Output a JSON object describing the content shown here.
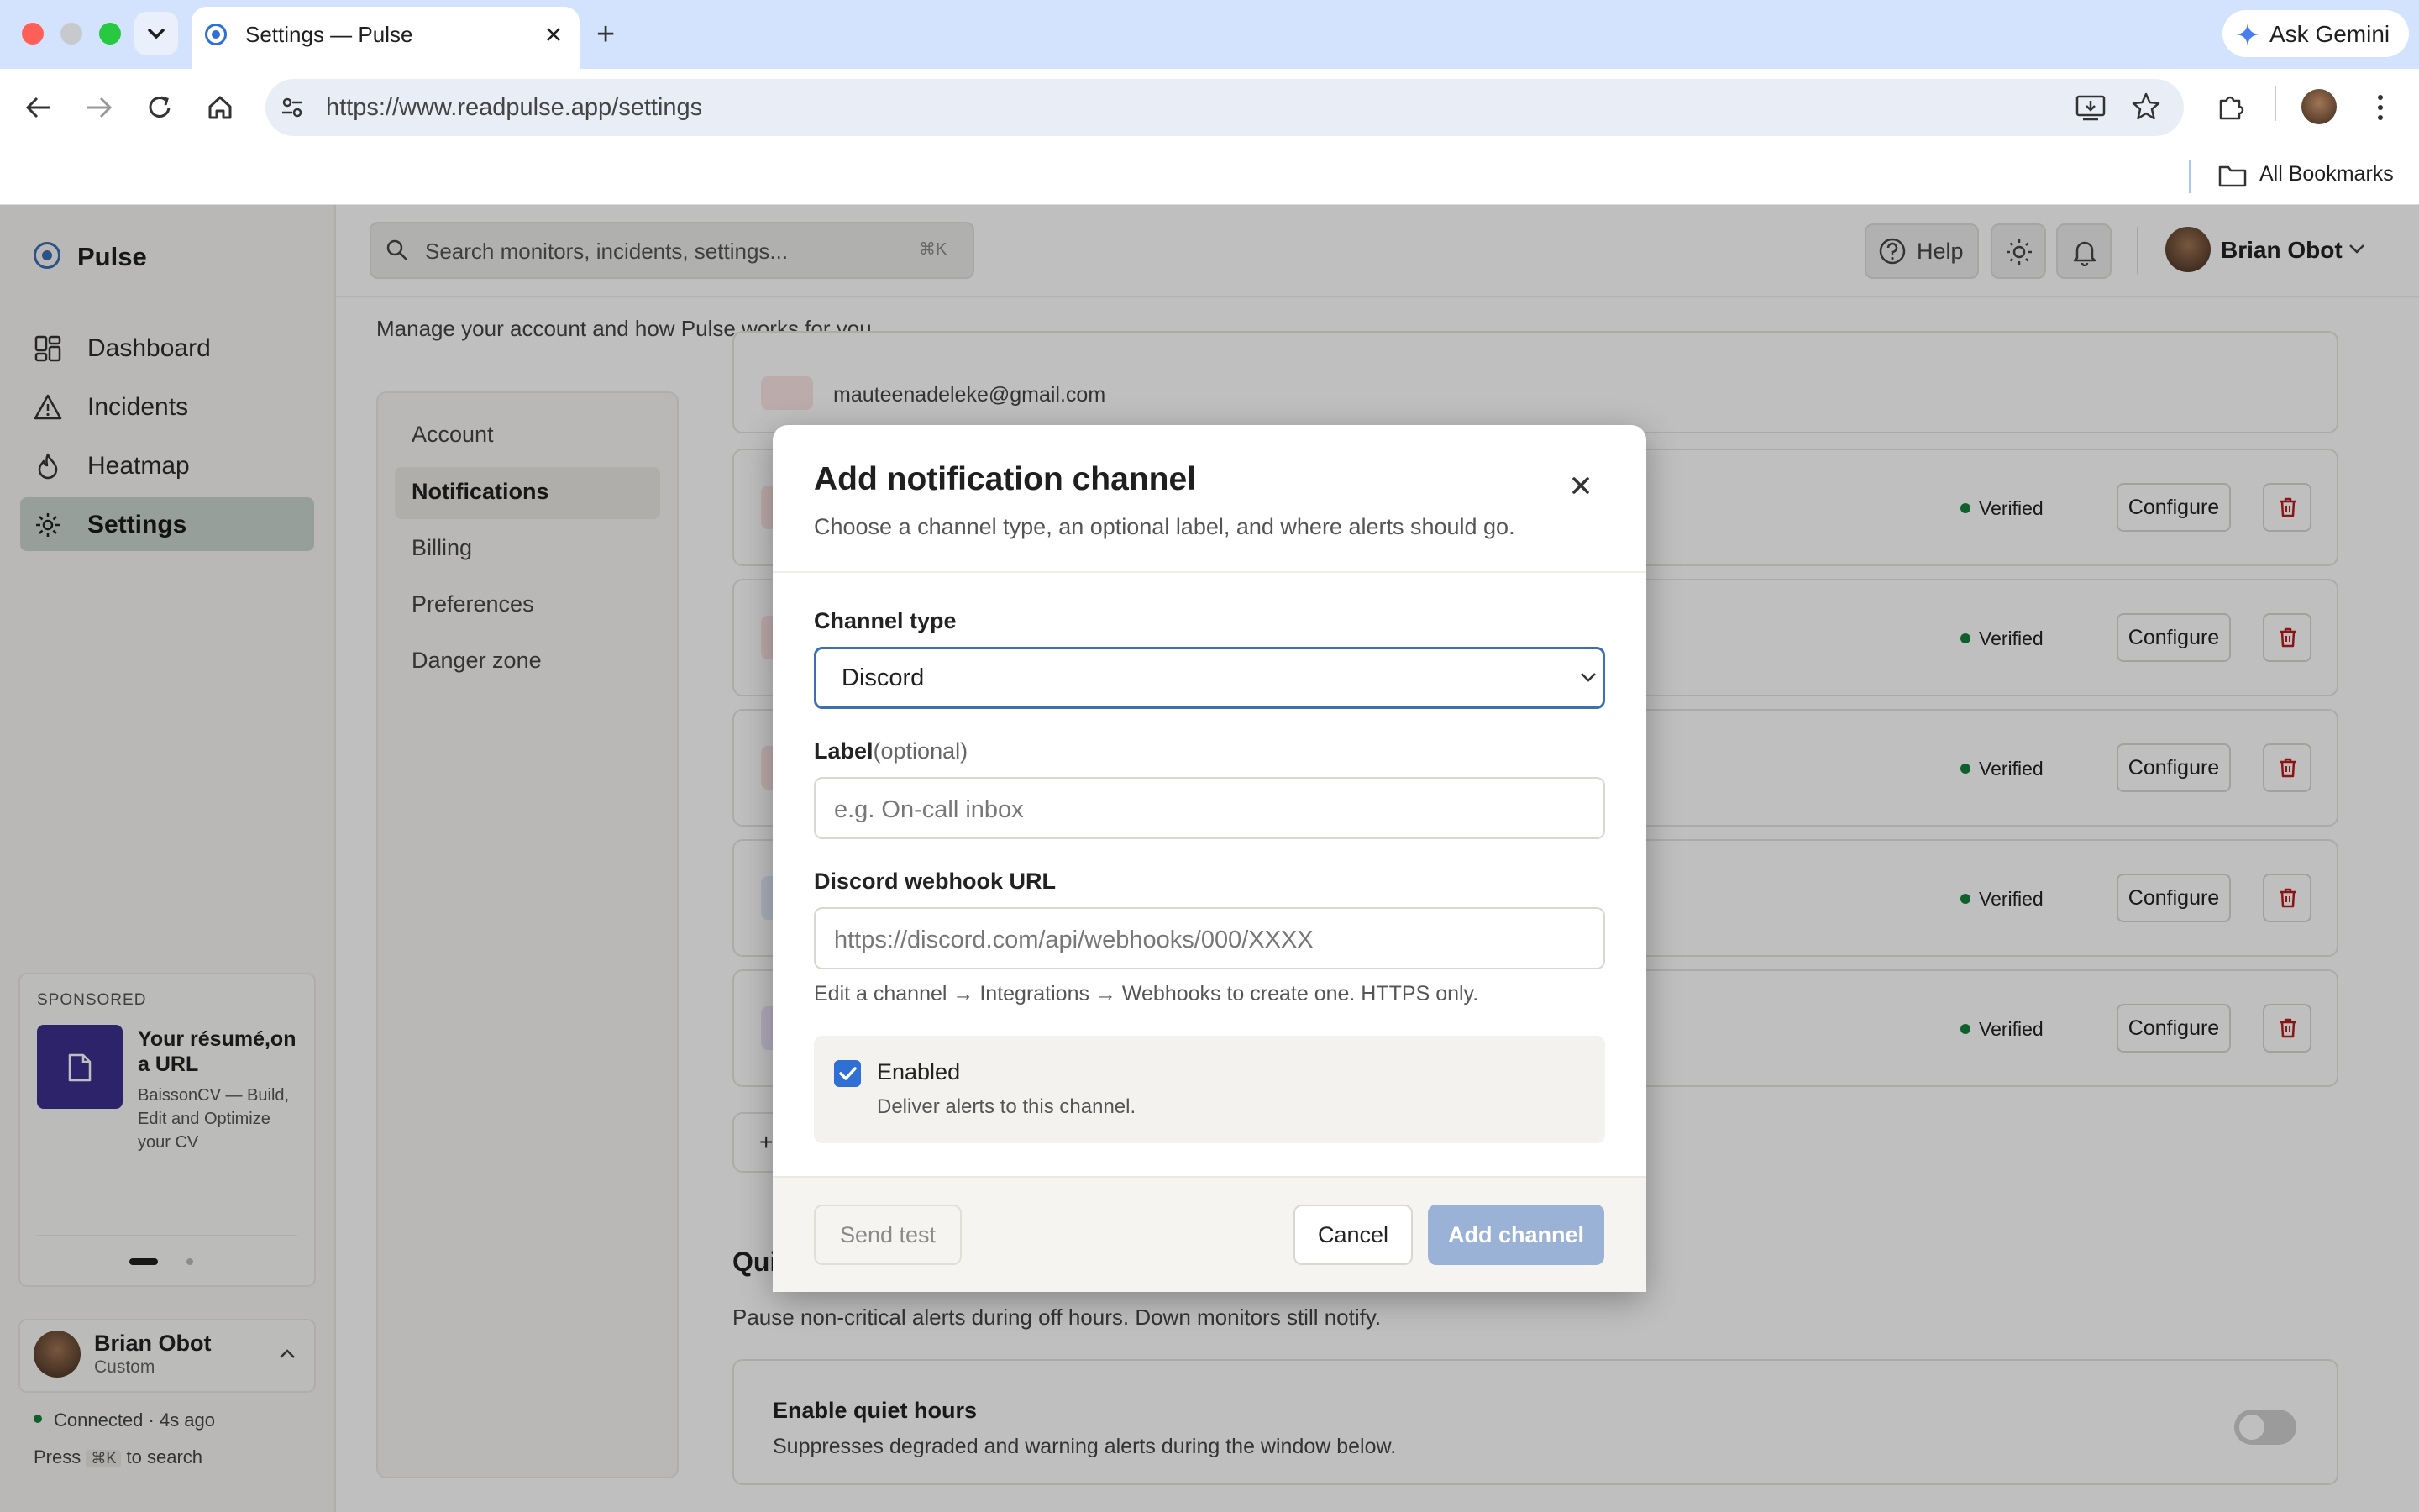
{
  "browser": {
    "tab_title": "Settings — Pulse",
    "url": "https://www.readpulse.app/settings",
    "ask_gemini": "Ask Gemini",
    "bookmarks_label": "All Bookmarks"
  },
  "sidebar": {
    "brand": "Pulse",
    "items": [
      {
        "label": "Dashboard"
      },
      {
        "label": "Incidents"
      },
      {
        "label": "Heatmap"
      },
      {
        "label": "Settings"
      }
    ],
    "sponsored": {
      "tag": "SPONSORED",
      "title": "Your résumé,on a URL",
      "desc": "BaissonCV — Build, Edit and Optimize your CV"
    },
    "user": {
      "name": "Brian Obot",
      "role": "Custom"
    },
    "status": "Connected · 4s ago",
    "press": "Press",
    "press_kbd": "⌘K",
    "to_search": "to search"
  },
  "header": {
    "search_placeholder": "Search monitors, incidents, settings...",
    "search_kbd": "⌘K",
    "help": "Help",
    "user_name": "Brian Obot"
  },
  "page": {
    "subtitle": "Manage your account and how Pulse works for you.",
    "settings_nav": [
      "Account",
      "Notifications",
      "Billing",
      "Preferences",
      "Danger zone"
    ],
    "email": "mauteenadeleke@gmail.com",
    "channels": [
      {
        "status": "Verified",
        "action": "Configure"
      },
      {
        "status": "Verified",
        "action": "Configure"
      },
      {
        "status": "Verified",
        "action": "Configure"
      },
      {
        "status": "Verified",
        "action": "Configure"
      },
      {
        "status": "Verified",
        "action": "Configure"
      }
    ],
    "quiet_heading": "Qui",
    "quiet_desc": "Pause non-critical alerts during off hours. Down monitors still notify.",
    "quiet_title": "Enable quiet hours",
    "quiet_subtitle": "Suppresses degraded and warning alerts during the window below.",
    "quiet_enabled": false
  },
  "modal": {
    "title": "Add notification channel",
    "desc": "Choose a channel type, an optional label, and where alerts should go.",
    "channel_type_label": "Channel type",
    "channel_type_value": "Discord",
    "label_label": "Label",
    "label_optional": "(optional)",
    "label_placeholder": "e.g. On-call inbox",
    "webhook_label": "Discord webhook URL",
    "webhook_placeholder": "https://discord.com/api/webhooks/000/XXXX",
    "hint": "Edit a channel → Integrations → Webhooks to create one. HTTPS only.",
    "enabled_label": "Enabled",
    "enabled_desc": "Deliver alerts to this channel.",
    "enabled": true,
    "send_test": "Send test",
    "cancel": "Cancel",
    "add_channel": "Add channel"
  },
  "colors": {
    "accent": "#2f6fd6",
    "verified": "#15803d",
    "nav_active": "#c9d5cc"
  }
}
